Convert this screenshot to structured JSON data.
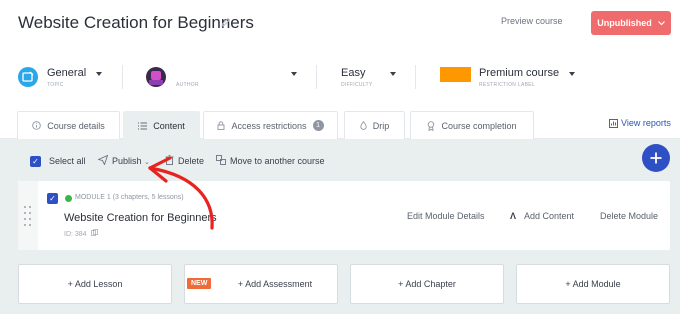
{
  "header": {
    "course_title": "Website Creation for Beginners",
    "preview_label": "Preview course",
    "status_label": "Unpublished",
    "status_color": "#f06b6b"
  },
  "meta": {
    "topic": {
      "value": "General",
      "label": "TOPIC"
    },
    "author": {
      "value": "",
      "label": "AUTHOR"
    },
    "difficulty": {
      "value": "Easy",
      "label": "DIFFICULTY"
    },
    "restriction": {
      "value": "Premium course",
      "label": "RESTRICTION LABEL",
      "color": "#ff9800"
    }
  },
  "tabs": [
    {
      "label": "Course details",
      "icon": "info-icon"
    },
    {
      "label": "Content",
      "icon": "list-icon",
      "active": true
    },
    {
      "label": "Access restrictions",
      "icon": "lock-icon",
      "badge": "1"
    },
    {
      "label": "Drip",
      "icon": "drop-icon"
    },
    {
      "label": "Course completion",
      "icon": "award-icon"
    }
  ],
  "view_reports": "View reports",
  "toolbar": {
    "select_all": "Select all",
    "publish": "Publish",
    "delete": "Delete",
    "move": "Move to another course",
    "add_icon": "plus-icon"
  },
  "module": {
    "meta": "MODULE 1  (3 chapters, 5 lessons)",
    "title": "Website Creation for Beginners",
    "id": "ID: 384",
    "edit": "Edit Module Details",
    "add_content": "Add Content",
    "delete": "Delete Module"
  },
  "add_buttons": {
    "lesson": "+ Add Lesson",
    "assessment": "+ Add Assessment",
    "assessment_badge": "NEW",
    "chapter": "+ Add Chapter",
    "module": "+ Add Module"
  },
  "accent_color": "#2f4fc4",
  "annotation_color": "#e8231f"
}
